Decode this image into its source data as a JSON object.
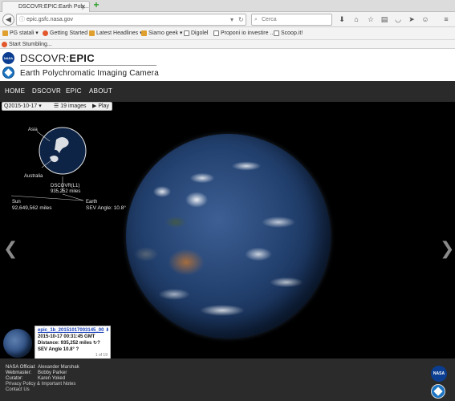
{
  "browser": {
    "tab_title": "DSCOVR:EPIC:Earth Poly...",
    "url": "epic.gsfc.nasa.gov",
    "search_placeholder": "Cerca",
    "bookmarks": [
      "PG statali",
      "Getting Started",
      "Latest Headlines",
      "Siamo geek",
      "Digolel",
      "Proponi io investire ...",
      "Scoop.it!"
    ],
    "stumble_label": "Start Stumbling..."
  },
  "header": {
    "nasa_logo_text": "NASA",
    "title_prefix": "DSCOVR:",
    "title_bold": "EPIC",
    "subtitle": "Earth Polychromatic Imaging Camera"
  },
  "nav": {
    "items": [
      "HOME",
      "DSCOVR",
      "EPIC",
      "ABOUT"
    ]
  },
  "viewer": {
    "date": "2015-10-17",
    "images_count": "19 images",
    "play_label": "▶ Play",
    "inset": {
      "asia": "Asia",
      "australia": "Australia",
      "dscovr_label": "DSCOVR(L1)",
      "dscovr_distance": "935,252 miles",
      "sun_label": "Sun",
      "sun_distance": "92,649,562 miles",
      "earth_label": "Earth",
      "sev_angle": "SEV Angle: 10.8°"
    },
    "info": {
      "filename": "epic_1b_20151017003145_00",
      "timestamp": "2015-10-17 00:31:45 GMT",
      "distance": "Distance: 935,252 miles",
      "sev_angle": "SEV Angle 10.8°",
      "counter": "1 of 19"
    }
  },
  "footer": {
    "nasa_official_label": "NASA Official:",
    "nasa_official_name": "Alexander Marshak",
    "webmaster_label": "Webmaster:",
    "webmaster_name": "Bobby Parker",
    "curator_label": "Curator:",
    "curator_name": "Karen Yoked",
    "privacy": "Privacy Policy & Important Notes",
    "contact": "Contact Us",
    "nasa_logo_text": "NASA"
  },
  "colors": {
    "nav_bg": "#2a2a2a",
    "footer_bg": "#2b2b2b",
    "viewer_bg": "#000000",
    "link": "#1a3fb8"
  }
}
